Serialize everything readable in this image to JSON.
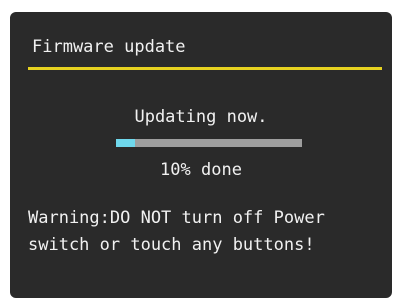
{
  "screen": {
    "title": "Firmware update",
    "status": "Updating now.",
    "progress": {
      "percent": 10,
      "label": "10% done"
    },
    "warning": {
      "line1": "Warning:DO NOT turn off Power",
      "line2": "switch or touch any buttons!"
    }
  },
  "colors": {
    "background": "#2a2a2a",
    "text": "#f1f1f1",
    "title_rule": "#e6d220",
    "progress_track": "#9e9e9e",
    "progress_fill": "#6fd8ec"
  }
}
